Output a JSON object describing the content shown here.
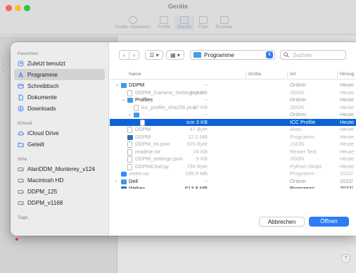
{
  "background_window": {
    "title": "Geräte",
    "toolbar": [
      {
        "label": "Profile reparieren",
        "icon": "plus-circle-icon",
        "selected": false
      },
      {
        "label": "Profile",
        "icon": "profile-icon",
        "selected": false
      },
      {
        "label": "Geräte",
        "icon": "display-icon",
        "selected": true
      },
      {
        "label": "Filter",
        "icon": "filter-icon",
        "selected": false
      },
      {
        "label": "Rechner",
        "icon": "calculator-icon",
        "selected": false
      }
    ],
    "help_label": "?"
  },
  "dialog": {
    "sidebar": {
      "favorites_heading": "Favoriten",
      "favorites": [
        {
          "label": "Zuletzt benutzt",
          "icon": "clock-icon",
          "selected": false
        },
        {
          "label": "Programme",
          "icon": "apps-icon",
          "selected": true
        },
        {
          "label": "Schreibtisch",
          "icon": "desktop-icon",
          "selected": false
        },
        {
          "label": "Dokumente",
          "icon": "document-icon",
          "selected": false
        },
        {
          "label": "Downloads",
          "icon": "download-icon",
          "selected": false
        }
      ],
      "icloud_heading": "iCloud",
      "icloud": [
        {
          "label": "iCloud Drive",
          "icon": "cloud-icon"
        },
        {
          "label": "Geteilt",
          "icon": "shared-folder-icon"
        }
      ],
      "locations_heading": "Orte",
      "locations": [
        {
          "label": "AlanDDM_Monterey_v124",
          "icon": "disk-icon"
        },
        {
          "label": "Macintosh HD",
          "icon": "disk-icon"
        },
        {
          "label": "DDPM_125",
          "icon": "disk-icon"
        },
        {
          "label": "DDPM_v1168",
          "icon": "disk-icon"
        }
      ],
      "tags_heading": "Tags"
    },
    "toolbar": {
      "back": "‹",
      "forward": "›",
      "list_view": "☰ ▾",
      "grid_view": "▦ ▾",
      "location": "Programme",
      "search_placeholder": "Suchen"
    },
    "columns": {
      "name": "Name",
      "size": "Größe",
      "kind": "Art",
      "date": "Hinzug"
    },
    "files": [
      {
        "name": "DDPM",
        "size": "--",
        "kind": "Ordner",
        "date": "Heute",
        "indent": 0,
        "disclosure": "⌄",
        "icon": "folder",
        "style": "norm"
      },
      {
        "name": "DDPM_Camera_Settings.json",
        "size": "144 KB",
        "kind": "JSON",
        "date": "Heute",
        "indent": 1,
        "disclosure": "",
        "icon": "doc",
        "style": "dim"
      },
      {
        "name": "Profiles",
        "size": "--",
        "kind": "Ordner",
        "date": "Heute",
        "indent": 1,
        "disclosure": "⌄",
        "icon": "folder",
        "style": "norm"
      },
      {
        "name": "icc_profile_sha256.json",
        "size": "17 KB",
        "kind": "JSON",
        "date": "Heute",
        "indent": 2,
        "disclosure": "",
        "icon": "doc",
        "style": "dim"
      },
      {
        "name": "",
        "size": "--",
        "kind": "Ordner",
        "date": "Heute",
        "indent": 2,
        "disclosure": "⌄",
        "icon": "folder",
        "style": "norm"
      },
      {
        "name": "icm",
        "size": "3 KB",
        "kind": "ICC Profile",
        "date": "Heute",
        "indent": 3,
        "disclosure": "",
        "icon": "doc",
        "style": "sel"
      },
      {
        "name": "DDPM",
        "size": "47 Byte",
        "kind": "Alias",
        "date": "Heute",
        "indent": 1,
        "disclosure": "",
        "icon": "doc",
        "style": "dim"
      },
      {
        "name": "DDPM",
        "size": "12.2 MB",
        "kind": "Programm",
        "date": "Heute",
        "indent": 1,
        "disclosure": "",
        "icon": "app",
        "style": "dim"
      },
      {
        "name": "DDPM_ini.json",
        "size": "325 Byte",
        "kind": "JSON",
        "date": "Heute",
        "indent": 1,
        "disclosure": "",
        "icon": "doc",
        "style": "dim"
      },
      {
        "name": "readme.txt",
        "size": "24 KB",
        "kind": "Reiner Text",
        "date": "Heute",
        "indent": 1,
        "disclosure": "",
        "icon": "doc",
        "style": "dim"
      },
      {
        "name": "DDPM_settings.json",
        "size": "9 KB",
        "kind": "JSON",
        "date": "Heute",
        "indent": 1,
        "disclosure": "",
        "icon": "doc",
        "style": "dim"
      },
      {
        "name": "DDPMCmd.py",
        "size": "796 Byte",
        "kind": "Python-Skript",
        "date": "Heute",
        "indent": 1,
        "disclosure": "",
        "icon": "doc",
        "style": "dim"
      },
      {
        "name": "zoom.us",
        "size": "188.9 MB",
        "kind": "Programm",
        "date": "2022/",
        "indent": 0,
        "disclosure": "",
        "icon": "zoom",
        "style": "dim"
      },
      {
        "name": "Dell",
        "size": "--",
        "kind": "Ordner",
        "date": "2022/",
        "indent": 0,
        "disclosure": "›",
        "icon": "folder",
        "style": "norm"
      },
      {
        "name": "Webex",
        "size": "613.8 MB",
        "kind": "Programm",
        "date": "2022/",
        "indent": 0,
        "disclosure": "",
        "icon": "app",
        "style": "clipped"
      }
    ],
    "buttons": {
      "cancel": "Abbrechen",
      "open": "Öffnen"
    }
  }
}
